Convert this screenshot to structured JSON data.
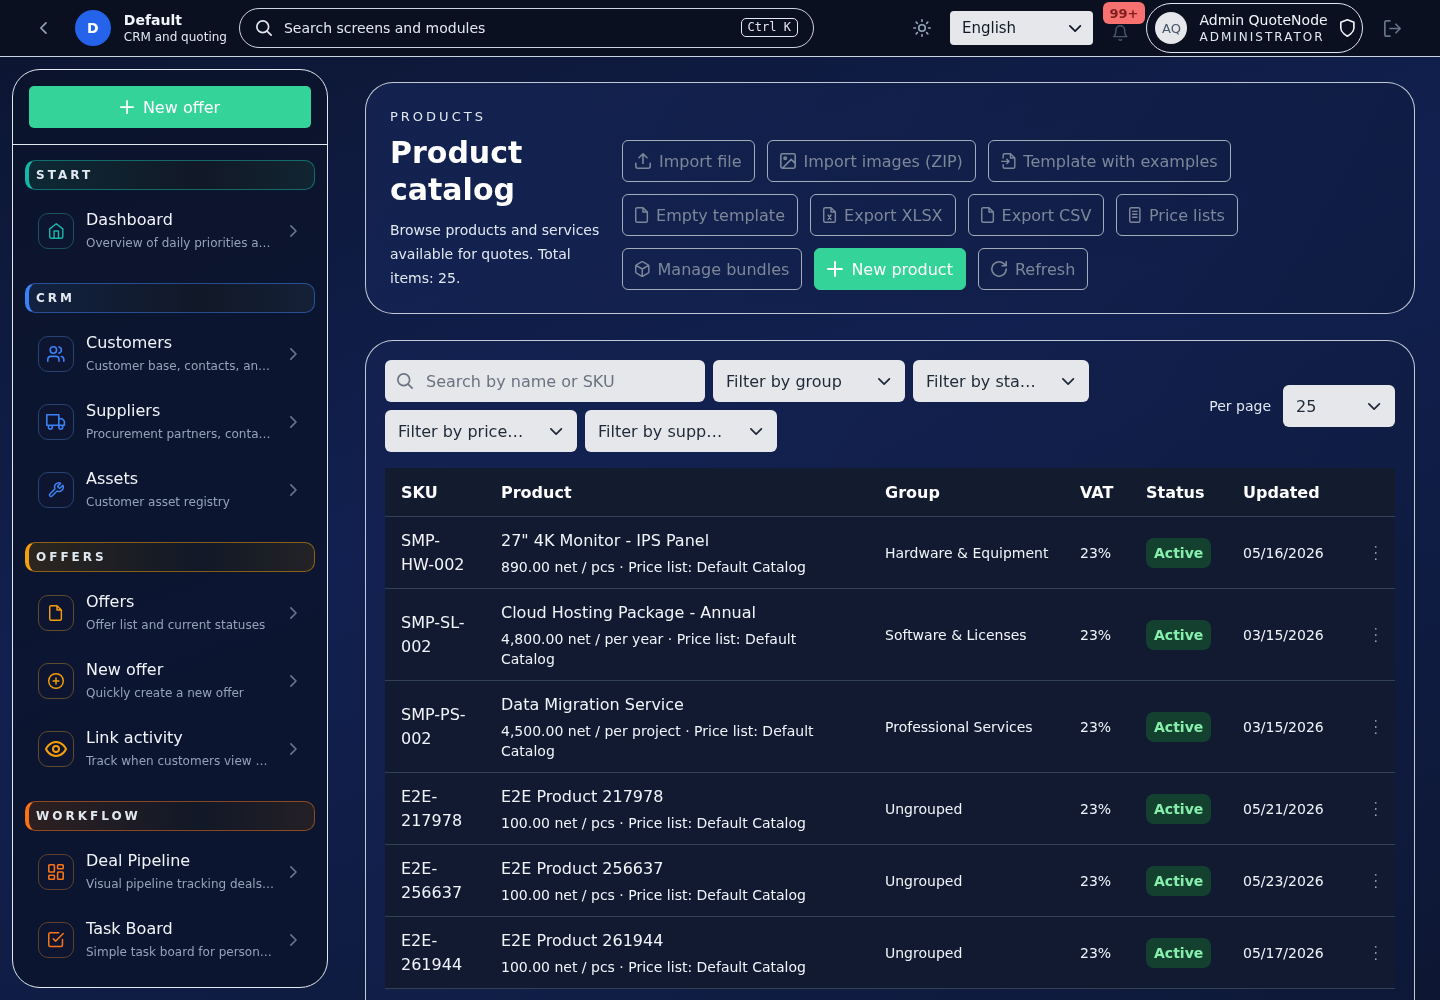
{
  "top_bar": {
    "workspace": {
      "initial": "D",
      "name": "Default",
      "subtitle": "CRM and quoting"
    },
    "search": {
      "placeholder": "Search screens and modules",
      "shortcut": "Ctrl K"
    },
    "language": "English",
    "notification_count": "99+",
    "user": {
      "initials": "AQ",
      "name": "Admin QuoteNode",
      "role": "ADMINISTRATOR"
    }
  },
  "sidebar": {
    "new_offer_button": "New offer",
    "sections": [
      {
        "title": "START",
        "color": "#14b8a6",
        "items": [
          {
            "title": "Dashboard",
            "subtitle": "Overview of daily priorities a…"
          }
        ]
      },
      {
        "title": "CRM",
        "color": "#3b82f6",
        "items": [
          {
            "title": "Customers",
            "subtitle": "Customer base, contacts, an…"
          },
          {
            "title": "Suppliers",
            "subtitle": "Procurement partners, conta…"
          },
          {
            "title": "Assets",
            "subtitle": "Customer asset registry"
          }
        ]
      },
      {
        "title": "OFFERS",
        "color": "#f59e0b",
        "items": [
          {
            "title": "Offers",
            "subtitle": "Offer list and current statuses"
          },
          {
            "title": "New offer",
            "subtitle": "Quickly create a new offer"
          },
          {
            "title": "Link activity",
            "subtitle": "Track when customers view …"
          }
        ]
      },
      {
        "title": "WORKFLOW",
        "color": "#f97316",
        "items": [
          {
            "title": "Deal Pipeline",
            "subtitle": "Visual pipeline tracking deals…"
          },
          {
            "title": "Task Board",
            "subtitle": "Simple task board for person…"
          }
        ]
      }
    ]
  },
  "page_header": {
    "eyebrow": "PRODUCTS",
    "title": "Product catalog",
    "description": "Browse products and services available for quotes. Total items: 25.",
    "button_rows": [
      [
        {
          "label": "Import file",
          "kind": "outline"
        },
        {
          "label": "Import images (ZIP)",
          "kind": "outline"
        },
        {
          "label": "Template with examples",
          "kind": "outline"
        }
      ],
      [
        {
          "label": "Empty template",
          "kind": "outline"
        },
        {
          "label": "Export XLSX",
          "kind": "outline"
        },
        {
          "label": "Export CSV",
          "kind": "outline"
        },
        {
          "label": "Price lists",
          "kind": "outline"
        }
      ],
      [
        {
          "label": "Manage bundles",
          "kind": "outline"
        },
        {
          "label": "New product",
          "kind": "primary"
        },
        {
          "label": "Refresh",
          "kind": "outline"
        }
      ]
    ]
  },
  "products_panel": {
    "search": {
      "placeholder": "Search by name or SKU"
    },
    "filters": [
      "Filter by group",
      "Filter by sta…",
      "Filter by price…",
      "Filter by supp…"
    ],
    "per_page": {
      "label": "Per page",
      "value": "25"
    },
    "table": {
      "columns": [
        "SKU",
        "Product",
        "Group",
        "VAT",
        "Status",
        "Updated"
      ],
      "rows": [
        {
          "sku": "SMP-HW-002",
          "name": "27\" 4K Monitor - IPS Panel",
          "details": "890.00 net / pcs · Price list: Default Catalog",
          "group": "Hardware & Equipment",
          "vat": "23%",
          "status": "Active",
          "updated": "05/16/2026"
        },
        {
          "sku": "SMP-SL-002",
          "name": "Cloud Hosting Package - Annual",
          "details": "4,800.00 net / per year · Price list: Default Catalog",
          "group": "Software & Licenses",
          "vat": "23%",
          "status": "Active",
          "updated": "03/15/2026"
        },
        {
          "sku": "SMP-PS-002",
          "name": "Data Migration Service",
          "details": "4,500.00 net / per project · Price list: Default Catalog",
          "group": "Professional Services",
          "vat": "23%",
          "status": "Active",
          "updated": "03/15/2026"
        },
        {
          "sku": "E2E-217978",
          "name": "E2E Product 217978",
          "details": "100.00 net / pcs · Price list: Default Catalog",
          "group": "Ungrouped",
          "vat": "23%",
          "status": "Active",
          "updated": "05/21/2026"
        },
        {
          "sku": "E2E-256637",
          "name": "E2E Product 256637",
          "details": "100.00 net / pcs · Price list: Default Catalog",
          "group": "Ungrouped",
          "vat": "23%",
          "status": "Active",
          "updated": "05/23/2026"
        },
        {
          "sku": "E2E-261944",
          "name": "E2E Product 261944",
          "details": "100.00 net / pcs · Price list: Default Catalog",
          "group": "Ungrouped",
          "vat": "23%",
          "status": "Active",
          "updated": "05/17/2026"
        }
      ]
    }
  }
}
